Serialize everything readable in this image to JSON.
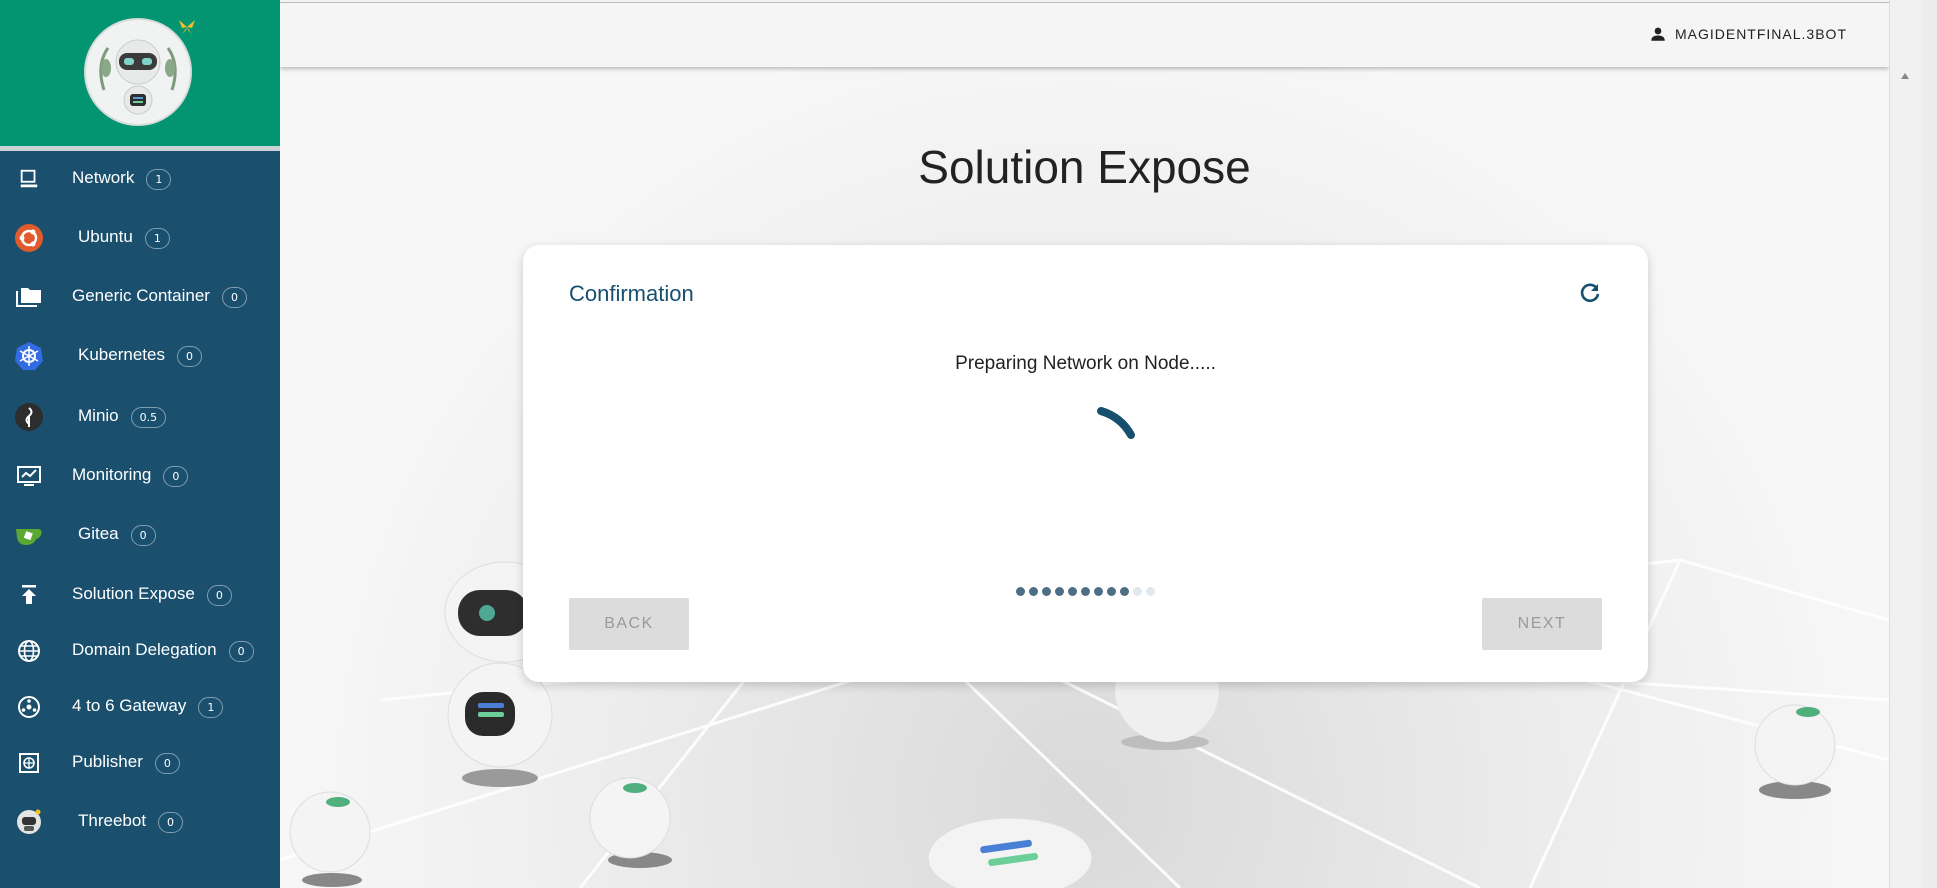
{
  "sidebar": {
    "items": [
      {
        "label": "Network",
        "badge": "1",
        "icon": "monitor-icon"
      },
      {
        "label": "Ubuntu",
        "badge": "1",
        "icon": "ubuntu-icon"
      },
      {
        "label": "Generic Container",
        "badge": "0",
        "icon": "folder-icon"
      },
      {
        "label": "Kubernetes",
        "badge": "0",
        "icon": "kubernetes-icon"
      },
      {
        "label": "Minio",
        "badge": "0.5",
        "icon": "minio-icon"
      },
      {
        "label": "Monitoring",
        "badge": "0",
        "icon": "monitoring-icon"
      },
      {
        "label": "Gitea",
        "badge": "0",
        "icon": "gitea-icon"
      },
      {
        "label": "Solution Expose",
        "badge": "0",
        "icon": "upload-icon"
      },
      {
        "label": "Domain Delegation",
        "badge": "0",
        "icon": "globe-icon"
      },
      {
        "label": "4 to 6 Gateway",
        "badge": "1",
        "icon": "gateway-icon"
      },
      {
        "label": "Publisher",
        "badge": "0",
        "icon": "web-icon"
      },
      {
        "label": "Threebot",
        "badge": "0",
        "icon": "threebot-icon"
      }
    ]
  },
  "header": {
    "user": "MAGIDENTFINAL.3BOT"
  },
  "page": {
    "title": "Solution Expose"
  },
  "card": {
    "title": "Confirmation",
    "status": "Preparing Network on Node.....",
    "steps_total": 11,
    "steps_done": 9,
    "back_label": "BACK",
    "next_label": "NEXT"
  },
  "colors": {
    "sidebar": "#1a4f6e",
    "logo_bg": "#039571",
    "accent": "#17506f"
  }
}
